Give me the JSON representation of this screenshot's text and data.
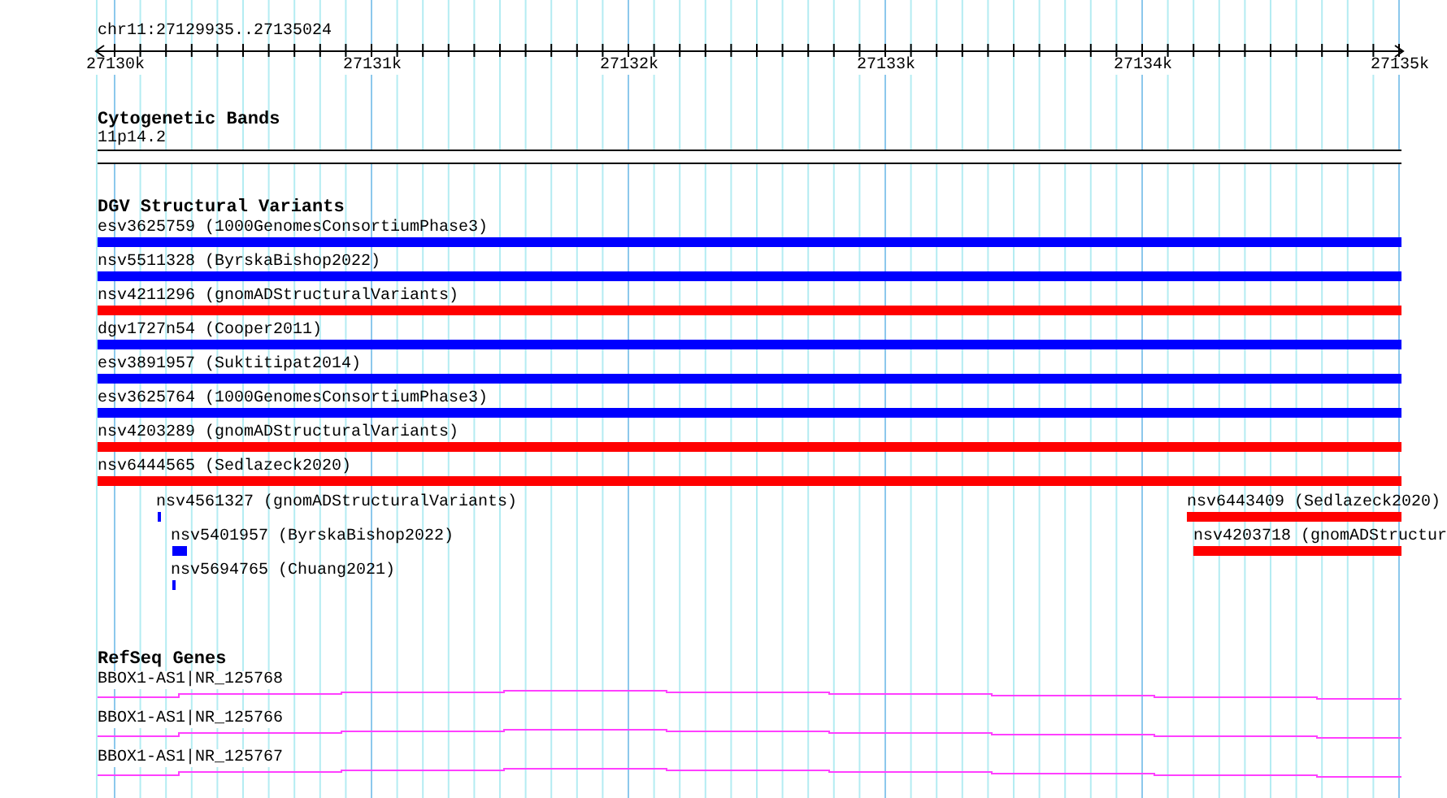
{
  "ruler": {
    "location": "chr11:27129935..27135024",
    "ticks": [
      "27130k",
      "27131k",
      "27132k",
      "27133k",
      "27134k",
      "27135k"
    ]
  },
  "tracks": [
    {
      "kind": "cytoband",
      "title": "Cytogenetic Bands",
      "features": [
        {
          "label": "11p14.2"
        }
      ]
    },
    {
      "kind": "variants",
      "title": "DGV Structural Variants",
      "features": [
        {
          "label": "esv3625759 (1000GenomesConsortiumPhase3)",
          "color": "#0000ff"
        },
        {
          "label": "nsv5511328 (ByrskaBishop2022)",
          "color": "#0000ff"
        },
        {
          "label": "nsv4211296 (gnomADStructuralVariants)",
          "color": "#ff0000"
        },
        {
          "label": "dgv1727n54 (Cooper2011)",
          "color": "#0000ff"
        },
        {
          "label": "esv3891957 (Suktitipat2014)",
          "color": "#0000ff"
        },
        {
          "label": "esv3625764 (1000GenomesConsortiumPhase3)",
          "color": "#0000ff"
        },
        {
          "label": "nsv4203289 (gnomADStructuralVariants)",
          "color": "#ff0000"
        },
        {
          "label": "nsv6444565 (Sedlazeck2020)",
          "color": "#ff0000"
        },
        {
          "label": "nsv4561327 (gnomADStructuralVariants)",
          "color": "#0000ff"
        },
        {
          "label": "nsv6443409 (Sedlazeck2020)",
          "color": "#ff0000"
        },
        {
          "label": "nsv5401957 (ByrskaBishop2022)",
          "color": "#0000ff"
        },
        {
          "label": "nsv4203718 (gnomADStructur",
          "color": "#ff0000"
        },
        {
          "label": "nsv5694765 (Chuang2021)",
          "color": "#0000ff"
        }
      ]
    },
    {
      "kind": "genes",
      "title": "RefSeq Genes",
      "features": [
        {
          "label": "BBOX1-AS1|NR_125768"
        },
        {
          "label": "BBOX1-AS1|NR_125766"
        },
        {
          "label": "BBOX1-AS1|NR_125767"
        }
      ]
    }
  ]
}
